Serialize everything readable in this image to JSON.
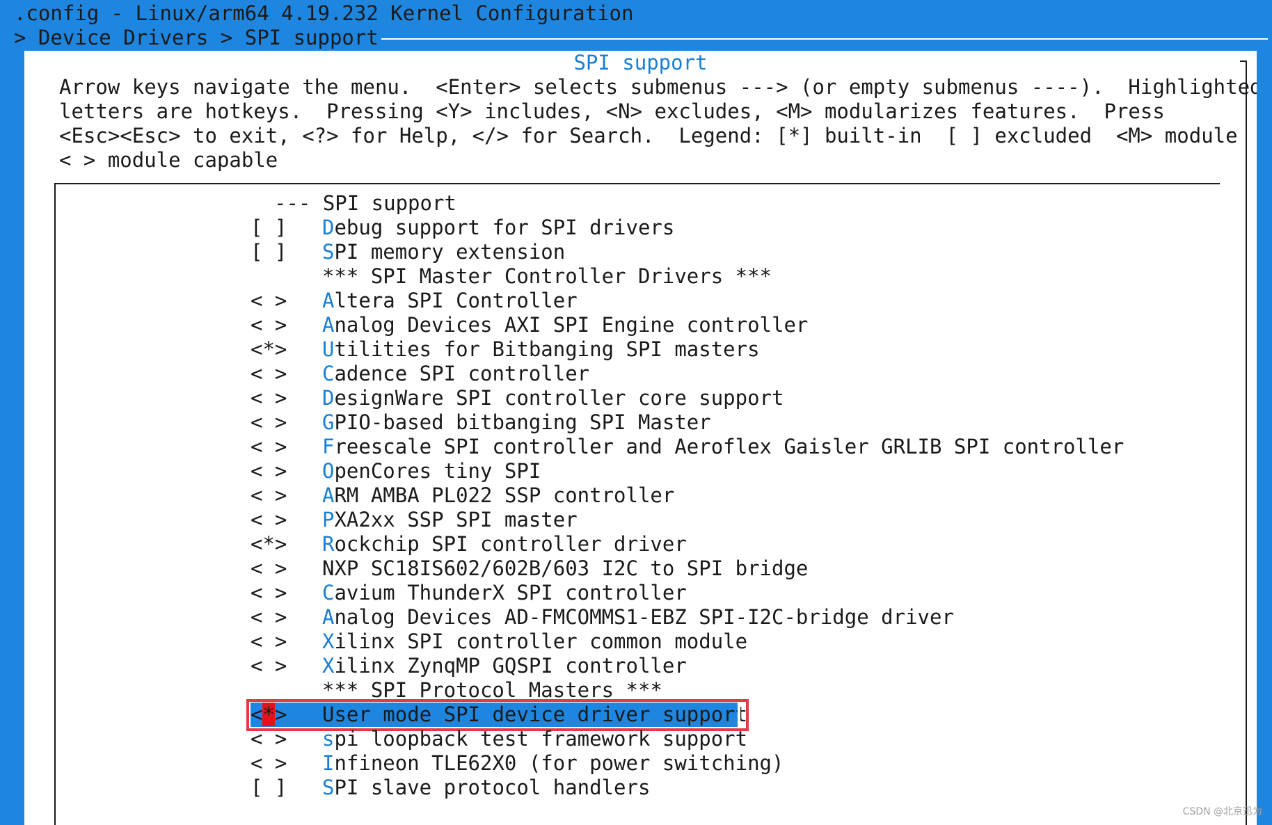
{
  "window": {
    "title": ".config - Linux/arm64 4.19.232 Kernel Configuration",
    "breadcrumb": "> Device Drivers > SPI support"
  },
  "dialog": {
    "title": "SPI support",
    "instructions": [
      "Arrow keys navigate the menu.  <Enter> selects submenus ---> (or empty submenus ----).  Highlighted",
      "letters are hotkeys.  Pressing <Y> includes, <N> excludes, <M> modularizes features.  Press",
      "<Esc><Esc> to exit, <?> for Help, </> for Search.  Legend: [*] built-in  [ ] excluded  <M> module",
      "< > module capable"
    ]
  },
  "menu": {
    "items": [
      {
        "state": "",
        "hotkey": "",
        "rest": "--- SPI support",
        "kind": "top"
      },
      {
        "state": "[ ]",
        "hotkey": "D",
        "rest": "ebug support for SPI drivers",
        "kind": "option"
      },
      {
        "state": "[ ]",
        "hotkey": "S",
        "rest": "PI memory extension",
        "kind": "option"
      },
      {
        "state": "",
        "hotkey": "",
        "rest": "*** SPI Master Controller Drivers ***",
        "kind": "section"
      },
      {
        "state": "< >",
        "hotkey": "A",
        "rest": "ltera SPI Controller",
        "kind": "option"
      },
      {
        "state": "< >",
        "hotkey": "A",
        "rest": "nalog Devices AXI SPI Engine controller",
        "kind": "option"
      },
      {
        "state": "<*>",
        "hotkey": "U",
        "rest": "tilities for Bitbanging SPI masters",
        "kind": "option"
      },
      {
        "state": "< >",
        "hotkey": "C",
        "rest": "adence SPI controller",
        "kind": "option"
      },
      {
        "state": "< >",
        "hotkey": "D",
        "rest": "esignWare SPI controller core support",
        "kind": "option"
      },
      {
        "state": "< >",
        "hotkey": "G",
        "rest": "PIO-based bitbanging SPI Master",
        "kind": "option"
      },
      {
        "state": "< >",
        "hotkey": "F",
        "rest": "reescale SPI controller and Aeroflex Gaisler GRLIB SPI controller",
        "kind": "option"
      },
      {
        "state": "< >",
        "hotkey": "O",
        "rest": "penCores tiny SPI",
        "kind": "option"
      },
      {
        "state": "< >",
        "hotkey": "A",
        "rest": "RM AMBA PL022 SSP controller",
        "kind": "option"
      },
      {
        "state": "< >",
        "hotkey": "P",
        "rest": "XA2xx SSP SPI master",
        "kind": "option"
      },
      {
        "state": "<*>",
        "hotkey": "R",
        "rest": "ockchip SPI controller driver",
        "kind": "option"
      },
      {
        "state": "< >",
        "hotkey": "NX",
        "rest": "P SC18IS602/602B/603 I2C to SPI bridge",
        "kind": "option-nx"
      },
      {
        "state": "< >",
        "hotkey": "C",
        "rest": "avium ThunderX SPI controller",
        "kind": "option"
      },
      {
        "state": "< >",
        "hotkey": "A",
        "rest": "nalog Devices AD-FMCOMMS1-EBZ SPI-I2C-bridge driver",
        "kind": "option"
      },
      {
        "state": "< >",
        "hotkey": "X",
        "rest": "ilinx SPI controller common module",
        "kind": "option"
      },
      {
        "state": "< >",
        "hotkey": "X",
        "rest": "ilinx ZynqMP GQSPI controller",
        "kind": "option"
      },
      {
        "state": "",
        "hotkey": "",
        "rest": "*** SPI Protocol Masters ***",
        "kind": "section"
      },
      {
        "state": "<*>",
        "hotkey": "U",
        "rest": "ser mode SPI device driver support",
        "kind": "selected"
      },
      {
        "state": "< >",
        "hotkey": "s",
        "rest": "pi loopback test framework support",
        "kind": "option"
      },
      {
        "state": "< >",
        "hotkey": "I",
        "rest": "nfineon TLE62X0 (for power switching)",
        "kind": "option"
      },
      {
        "state": "[ ]",
        "hotkey": "S",
        "rest": "PI slave protocol handlers",
        "kind": "option"
      }
    ]
  },
  "watermark": "CSDN @北京迅为",
  "colors": {
    "background": "#1f86e0",
    "hotkey": "#1a7fd4",
    "selection": "#1f86e0",
    "annotation": "#e53a45",
    "cursor": "#e8101a"
  }
}
